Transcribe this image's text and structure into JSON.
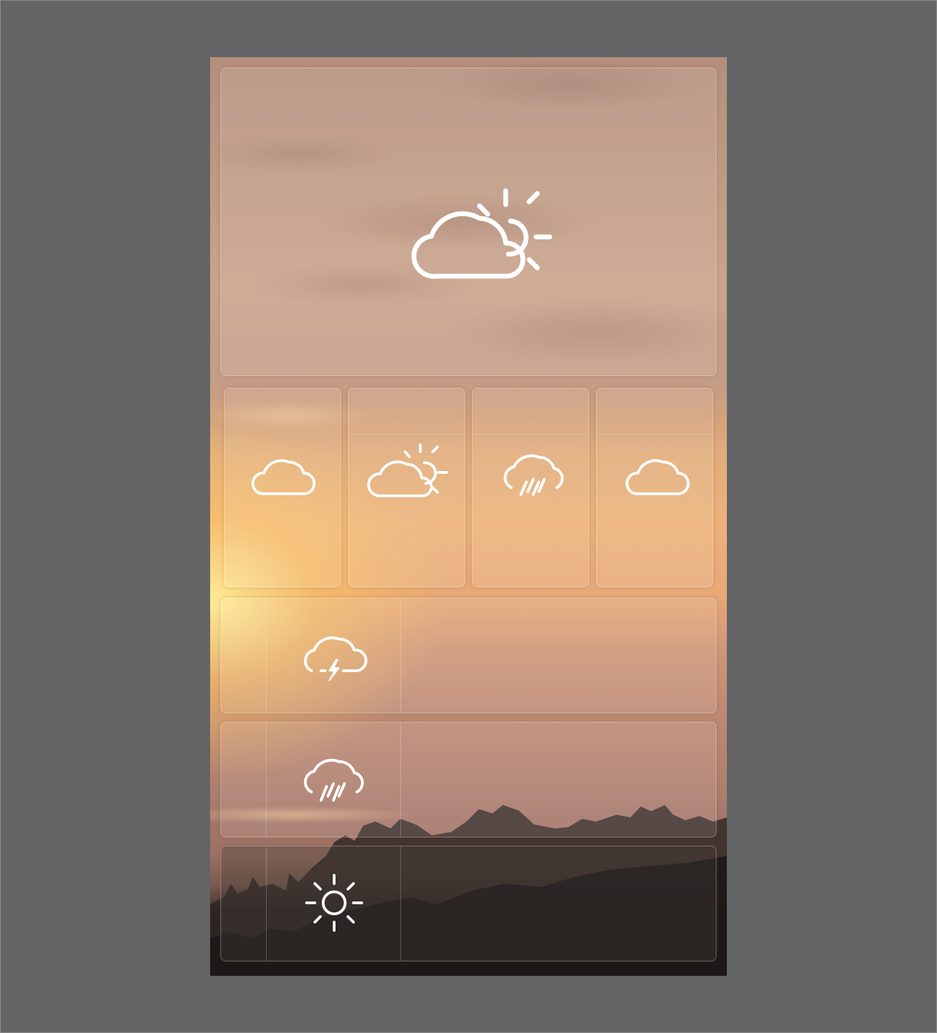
{
  "app": {
    "name": ""
  },
  "hero": {
    "condition_icon": "partly-cloudy-icon",
    "label": ""
  },
  "forecast": [
    {
      "icon": "cloud-icon",
      "label": ""
    },
    {
      "icon": "partly-cloudy-icon",
      "label": ""
    },
    {
      "icon": "rain-cloud-icon",
      "label": ""
    },
    {
      "icon": "cloud-icon",
      "label": ""
    }
  ],
  "rows": [
    {
      "icon": "thunderstorm-icon",
      "label": ""
    },
    {
      "icon": "rain-cloud-icon",
      "label": ""
    },
    {
      "icon": "sun-icon",
      "label": ""
    }
  ],
  "colors": {
    "background": "#636466",
    "icon_stroke": "#ffffff",
    "tile_border": "rgba(255,255,255,0.28)"
  }
}
